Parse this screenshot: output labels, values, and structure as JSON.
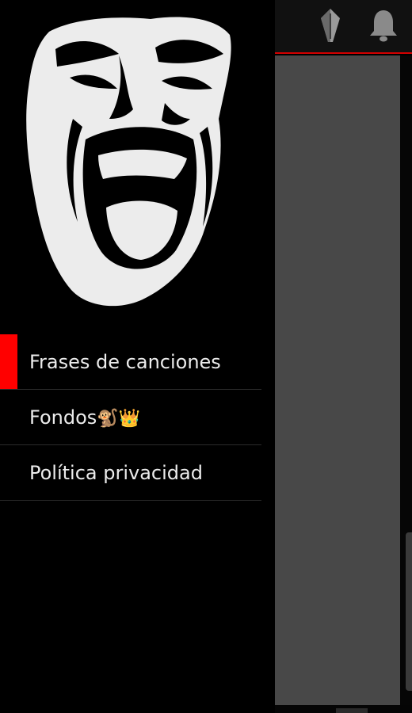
{
  "toolbar": {
    "actions": [
      {
        "icon": "pen-nib-icon"
      },
      {
        "icon": "bell-icon"
      }
    ],
    "accent_color": "#d40000"
  },
  "drawer": {
    "header_image": "screaming-face-logo",
    "menu_items": [
      {
        "label": "Frases de canciones",
        "active": true
      },
      {
        "label": "Fondos",
        "emoji": "🐒👑",
        "active": false
      },
      {
        "label": "Política privacidad",
        "active": false
      }
    ],
    "active_color": "#ff0000"
  }
}
